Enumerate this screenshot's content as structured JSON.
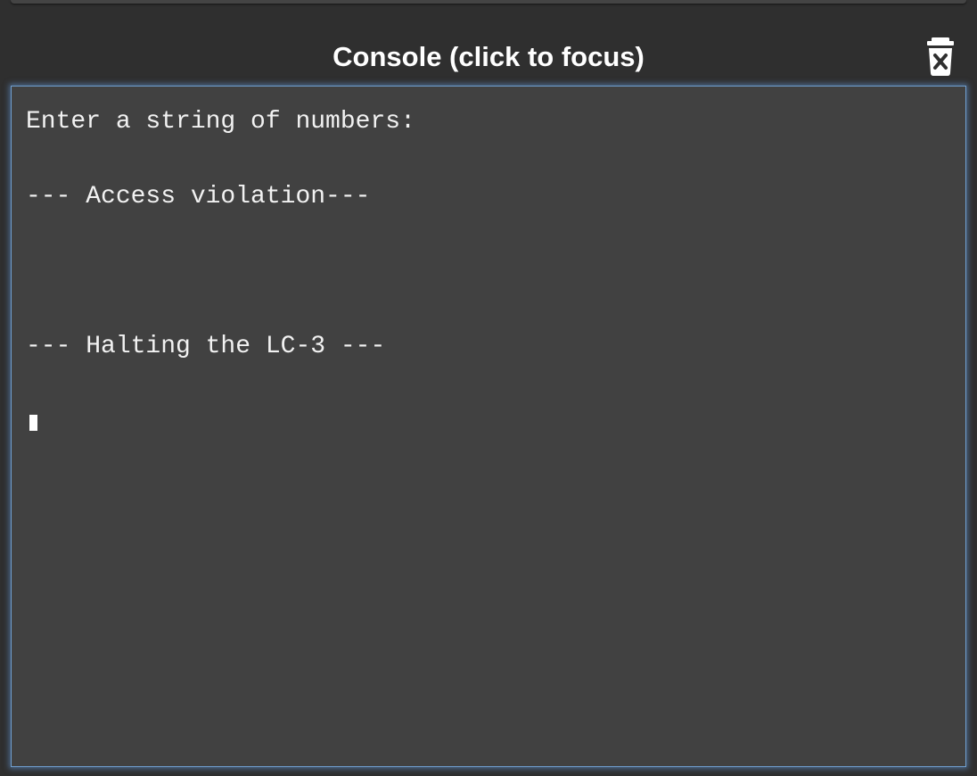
{
  "console": {
    "title": "Console (click to focus)",
    "clear_icon": "trash-x-icon",
    "lines": [
      "Enter a string of numbers:",
      "",
      "--- Access violation---",
      "",
      "",
      "",
      "--- Halting the LC-3 ---",
      ""
    ]
  },
  "colors": {
    "background": "#2f2f2f",
    "console_bg": "#414141",
    "focus_glow": "#6f9fd0",
    "text": "#f2f2f2"
  }
}
